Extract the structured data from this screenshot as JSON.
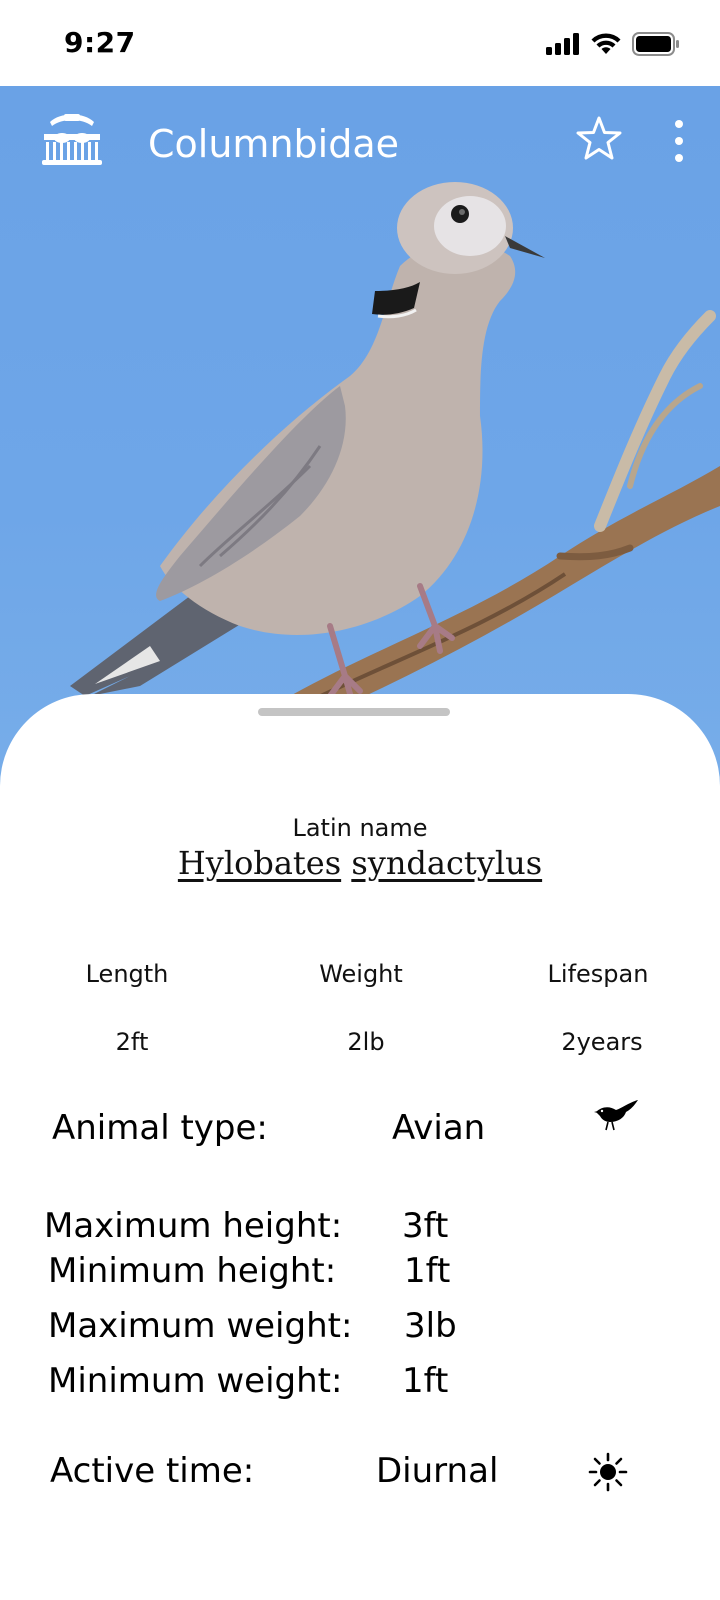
{
  "status_bar": {
    "time": "9:27",
    "icons": [
      "signal-icon",
      "wifi-icon",
      "battery-icon"
    ]
  },
  "app_bar": {
    "title": "Columnbidae",
    "logo_icon": "zoo-logo-icon",
    "actions": [
      "star-icon",
      "more-vert-icon"
    ]
  },
  "hero": {
    "image_subject": "dove-on-branch-photo"
  },
  "details": {
    "latin_label": "Latin name",
    "latin_genus": "Hylobates",
    "latin_species": "syndactylus",
    "stats": [
      {
        "label": "Length",
        "value": "2ft"
      },
      {
        "label": "Weight",
        "value": "2lb"
      },
      {
        "label": "Lifespan",
        "value": "2years"
      }
    ],
    "animal_type": {
      "label": "Animal type:",
      "value": "Avian",
      "icon": "bird-icon"
    },
    "measurements": [
      {
        "label": "Maximum height:",
        "value": "3ft"
      },
      {
        "label": "Minimum height:",
        "value": "1ft"
      },
      {
        "label": "Maximum weight:",
        "value": "3lb"
      },
      {
        "label": "Minimum weight:",
        "value": "1ft"
      }
    ],
    "active_time": {
      "label": "Active time:",
      "value": "Diurnal",
      "icon": "sun-icon"
    }
  },
  "colors": {
    "sky": "#6ea6e8",
    "sheet": "#ffffff",
    "handle": "#c4c4c4",
    "appbar_text": "#ffffff"
  }
}
